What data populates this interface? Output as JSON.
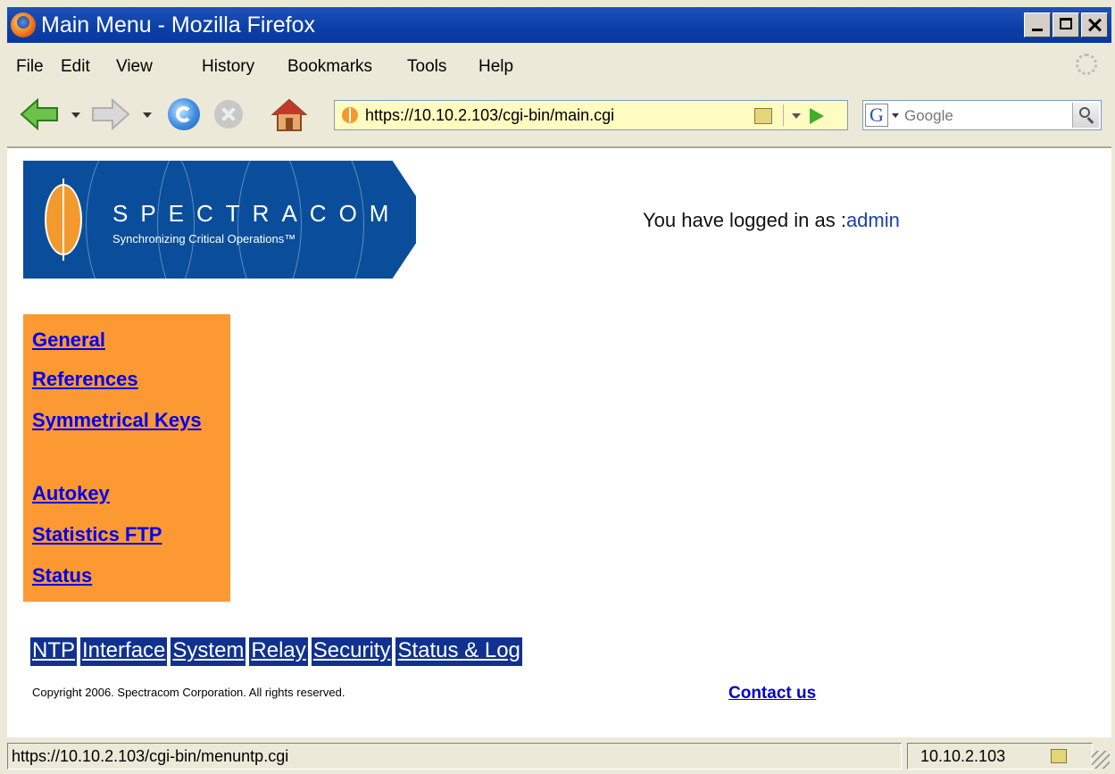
{
  "window": {
    "title": "Main Menu - Mozilla Firefox"
  },
  "menubar": {
    "items": [
      "File",
      "Edit",
      "View",
      "History",
      "Bookmarks",
      "Tools",
      "Help"
    ]
  },
  "toolbar": {
    "url": "https://10.10.2.103/cgi-bin/main.cgi",
    "search_placeholder": "Google",
    "search_engine_letter": "G"
  },
  "banner": {
    "brand": "SPECTRACOM",
    "tagline": "Synchronizing Critical Operations™"
  },
  "login": {
    "prefix": "You have logged in as :",
    "user": "admin"
  },
  "sidenav": {
    "items": [
      "General",
      "References",
      "Symmetrical Keys",
      "Autokey",
      "Statistics FTP",
      "Status"
    ]
  },
  "tabs": [
    "NTP",
    "Interface",
    "System",
    "Relay",
    "Security",
    "Status & Log"
  ],
  "footer": {
    "copyright": "Copyright 2006. Spectracom Corporation. All rights reserved.",
    "contact": "Contact us"
  },
  "statusbar": {
    "message": "https://10.10.2.103/cgi-bin/menuntp.cgi",
    "host": "10.10.2.103"
  },
  "colors": {
    "titlebar": "#0b3ea7",
    "banner": "#0a4e9b",
    "sidenav": "#fd9933",
    "tab": "#10318f",
    "link": "#0000ee"
  }
}
